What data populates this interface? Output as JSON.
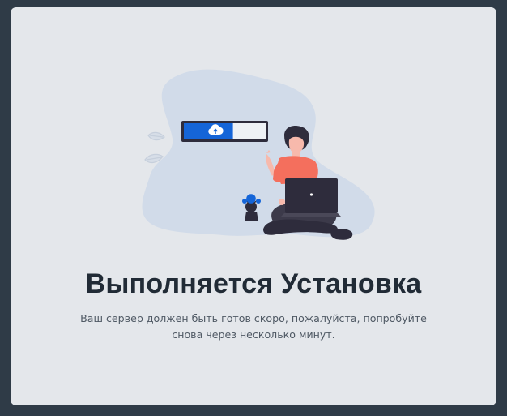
{
  "page": {
    "title": "Выполняется Установка",
    "message": "Ваш сервер должен быть готов скоро, пожалуйста, попробуйте снова через несколько минут."
  },
  "illustration": {
    "upload_progress": 0.6,
    "icon": "cloud-upload-icon"
  },
  "colors": {
    "background": "#2f3b47",
    "card": "#e4e7eb",
    "blob": "#d1dbe9",
    "accent": "#1565d8",
    "shirt": "#f46f5d",
    "dark": "#2e2c3c"
  }
}
